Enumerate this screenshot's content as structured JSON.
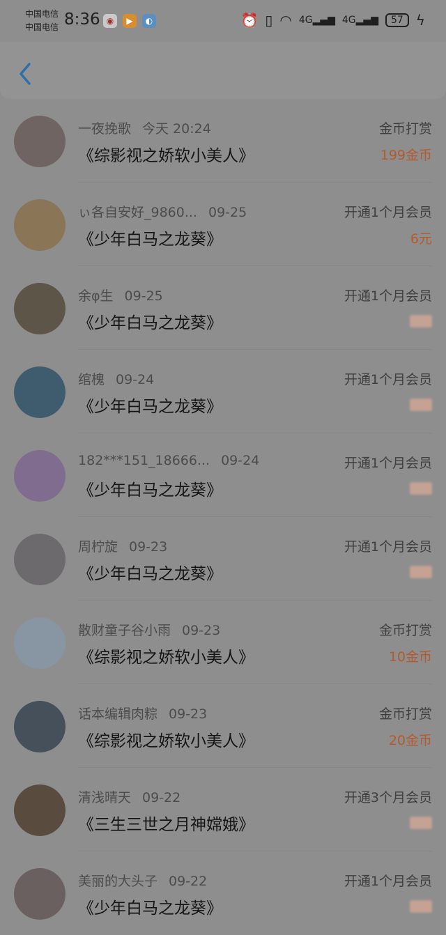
{
  "status_bar": {
    "carrier_1": "中国电信",
    "carrier_2": "中国电信",
    "time": "8:36",
    "network_1": "4G",
    "network_2": "4G",
    "battery": "57"
  },
  "nav": {
    "back_icon": "chevron-left-icon"
  },
  "records": [
    {
      "name": "一夜挽歌",
      "time": "今天 20:24",
      "title": "《综影视之娇软小美人》",
      "type": "金币打赏",
      "amount": "199金币",
      "avatar_color": "#6f6462"
    },
    {
      "name": "ぃ各自安好_9860...",
      "time": "09-25",
      "title": "《少年白马之龙葵》",
      "type": "开通1个月会员",
      "amount": "6元",
      "avatar_color": "#8a7556"
    },
    {
      "name": "余φ生",
      "time": "09-25",
      "title": "《少年白马之龙葵》",
      "type": "开通1个月会员",
      "amount": "",
      "avatar_color": "#5e5549"
    },
    {
      "name": "绾槐",
      "time": "09-24",
      "title": "《少年白马之龙葵》",
      "type": "开通1个月会员",
      "amount": "",
      "avatar_color": "#3f5c6e"
    },
    {
      "name": "182***151_18666...",
      "time": "09-24",
      "title": "《少年白马之龙葵》",
      "type": "开通1个月会员",
      "amount": "",
      "avatar_color": "#7f6c8e"
    },
    {
      "name": "周柠旋",
      "time": "09-23",
      "title": "《少年白马之龙葵》",
      "type": "开通1个月会员",
      "amount": "",
      "avatar_color": "#6c6a6c"
    },
    {
      "name": "散财童子谷小雨",
      "time": "09-23",
      "title": "《综影视之娇软小美人》",
      "type": "金币打赏",
      "amount": "10金币",
      "avatar_color": "#8896a3"
    },
    {
      "name": "话本编辑肉粽",
      "time": "09-23",
      "title": "《综影视之娇软小美人》",
      "type": "金币打赏",
      "amount": "20金币",
      "avatar_color": "#46505a"
    },
    {
      "name": "清浅晴天",
      "time": "09-22",
      "title": "《三生三世之月神嫦娥》",
      "type": "开通3个月会员",
      "amount": "",
      "avatar_color": "#5a4b3f"
    },
    {
      "name": "美丽的大头子",
      "time": "09-22",
      "title": "《少年白马之龙葵》",
      "type": "开通1个月会员",
      "amount": "",
      "avatar_color": "#6a6060"
    }
  ]
}
